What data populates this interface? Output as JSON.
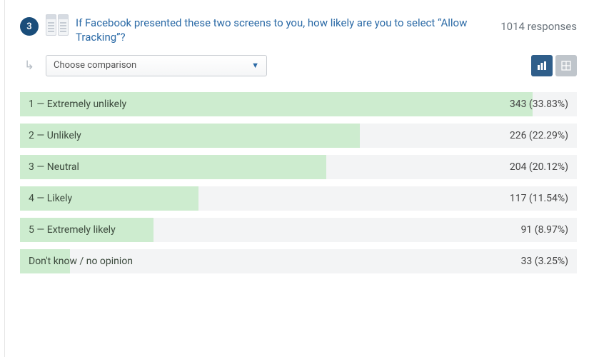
{
  "question": {
    "number": "3",
    "text": "If Facebook presented these two screens to you, how likely are you to select “Allow Tracking”?",
    "responses_label": "1014 responses",
    "total_responses": 1014
  },
  "controls": {
    "compare_placeholder": "Choose comparison"
  },
  "chart_data": {
    "type": "bar",
    "orientation": "horizontal",
    "title": "If Facebook presented these two screens to you, how likely are you to select “Allow Tracking”?",
    "xlabel": "",
    "ylabel": "",
    "total": 1014,
    "categories": [
      "1 — Extremely unlikely",
      "2 — Unlikely",
      "3 — Neutral",
      "4 — Likely",
      "5 — Extremely likely",
      "Don't know / no opinion"
    ],
    "values": [
      343,
      226,
      204,
      117,
      91,
      33
    ],
    "percentages": [
      33.83,
      22.29,
      20.12,
      11.54,
      8.97,
      3.25
    ],
    "value_labels": [
      "343 (33.83%)",
      "226 (22.29%)",
      "204 (20.12%)",
      "117 (11.54%)",
      "91 (8.97%)",
      "33 (3.25%)"
    ],
    "bar_fill_pct": [
      92,
      61,
      55,
      32,
      24,
      9
    ],
    "colors": {
      "fill": "#cdeccf",
      "track": "#f3f4f5"
    }
  }
}
